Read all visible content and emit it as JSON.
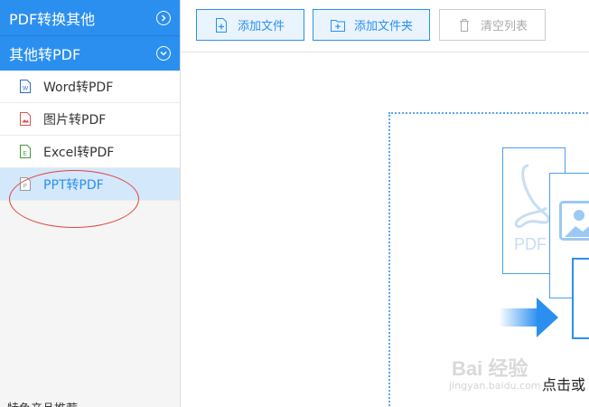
{
  "sidebar": {
    "groups": [
      {
        "label": "PDF转换其他",
        "icon": "chevron-right-icon"
      },
      {
        "label": "其他转PDF",
        "icon": "chevron-down-icon"
      }
    ],
    "items": [
      {
        "label": "Word转PDF",
        "icon": "word-file-icon",
        "icon_color": "#2b6cc4"
      },
      {
        "label": "图片转PDF",
        "icon": "image-file-icon",
        "icon_color": "#d9534f"
      },
      {
        "label": "Excel转PDF",
        "icon": "excel-file-icon",
        "icon_color": "#3c9a3c"
      },
      {
        "label": "PPT转PDF",
        "icon": "ppt-file-icon",
        "icon_color": "#999999"
      }
    ],
    "bottom_label": "特色产品推荐"
  },
  "toolbar": {
    "add_file": "添加文件",
    "add_folder": "添加文件夹",
    "clear_list": "清空列表"
  },
  "drop_area": {
    "pdf_label": "PDF",
    "hint": "点击或"
  },
  "watermark": {
    "brand": "Bai 经验",
    "url": "jingyan.baidu.com"
  },
  "colors": {
    "accent": "#2b8ff0",
    "active_bg": "#d4e8fb",
    "annotation": "#e0453c"
  }
}
